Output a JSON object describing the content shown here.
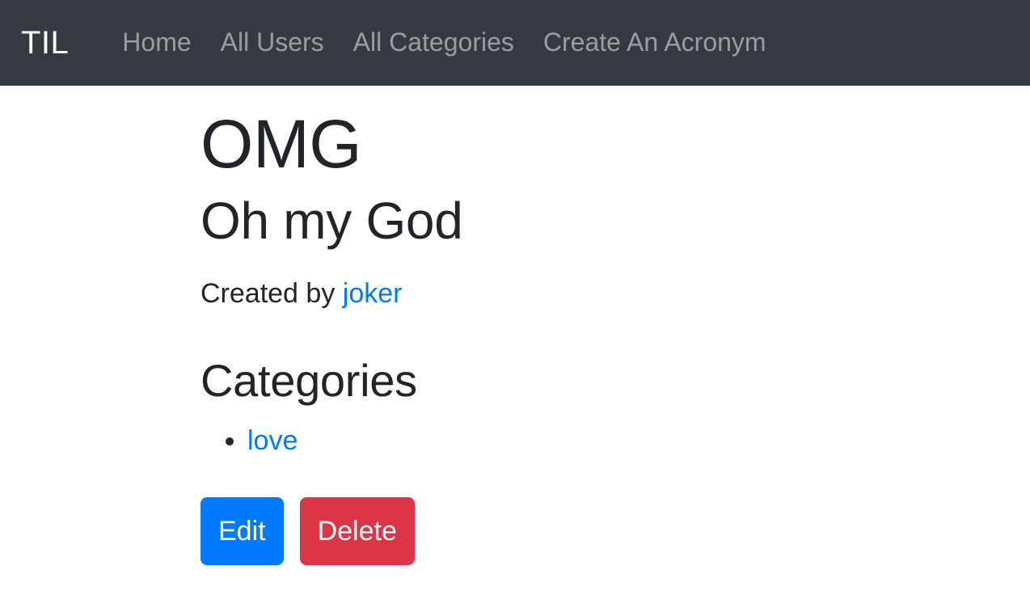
{
  "navbar": {
    "brand": "TIL",
    "background_color": "#343a40",
    "brand_color": "#ffffff",
    "link_color": "rgba(255,255,255,0.5)",
    "items": [
      {
        "label": "Home"
      },
      {
        "label": "All Users"
      },
      {
        "label": "All Categories"
      },
      {
        "label": "Create An Acronym"
      }
    ]
  },
  "main": {
    "acronym_short": "OMG",
    "acronym_long": "Oh my God",
    "created_by_prefix": "Created by",
    "creator": "joker",
    "categories_heading": "Categories",
    "categories": [
      {
        "label": "love"
      }
    ],
    "link_color": "#007bff",
    "text_color": "#212529"
  },
  "actions": {
    "edit_label": "Edit",
    "edit_color": "#007bff",
    "delete_label": "Delete",
    "delete_color": "#dc3545"
  }
}
